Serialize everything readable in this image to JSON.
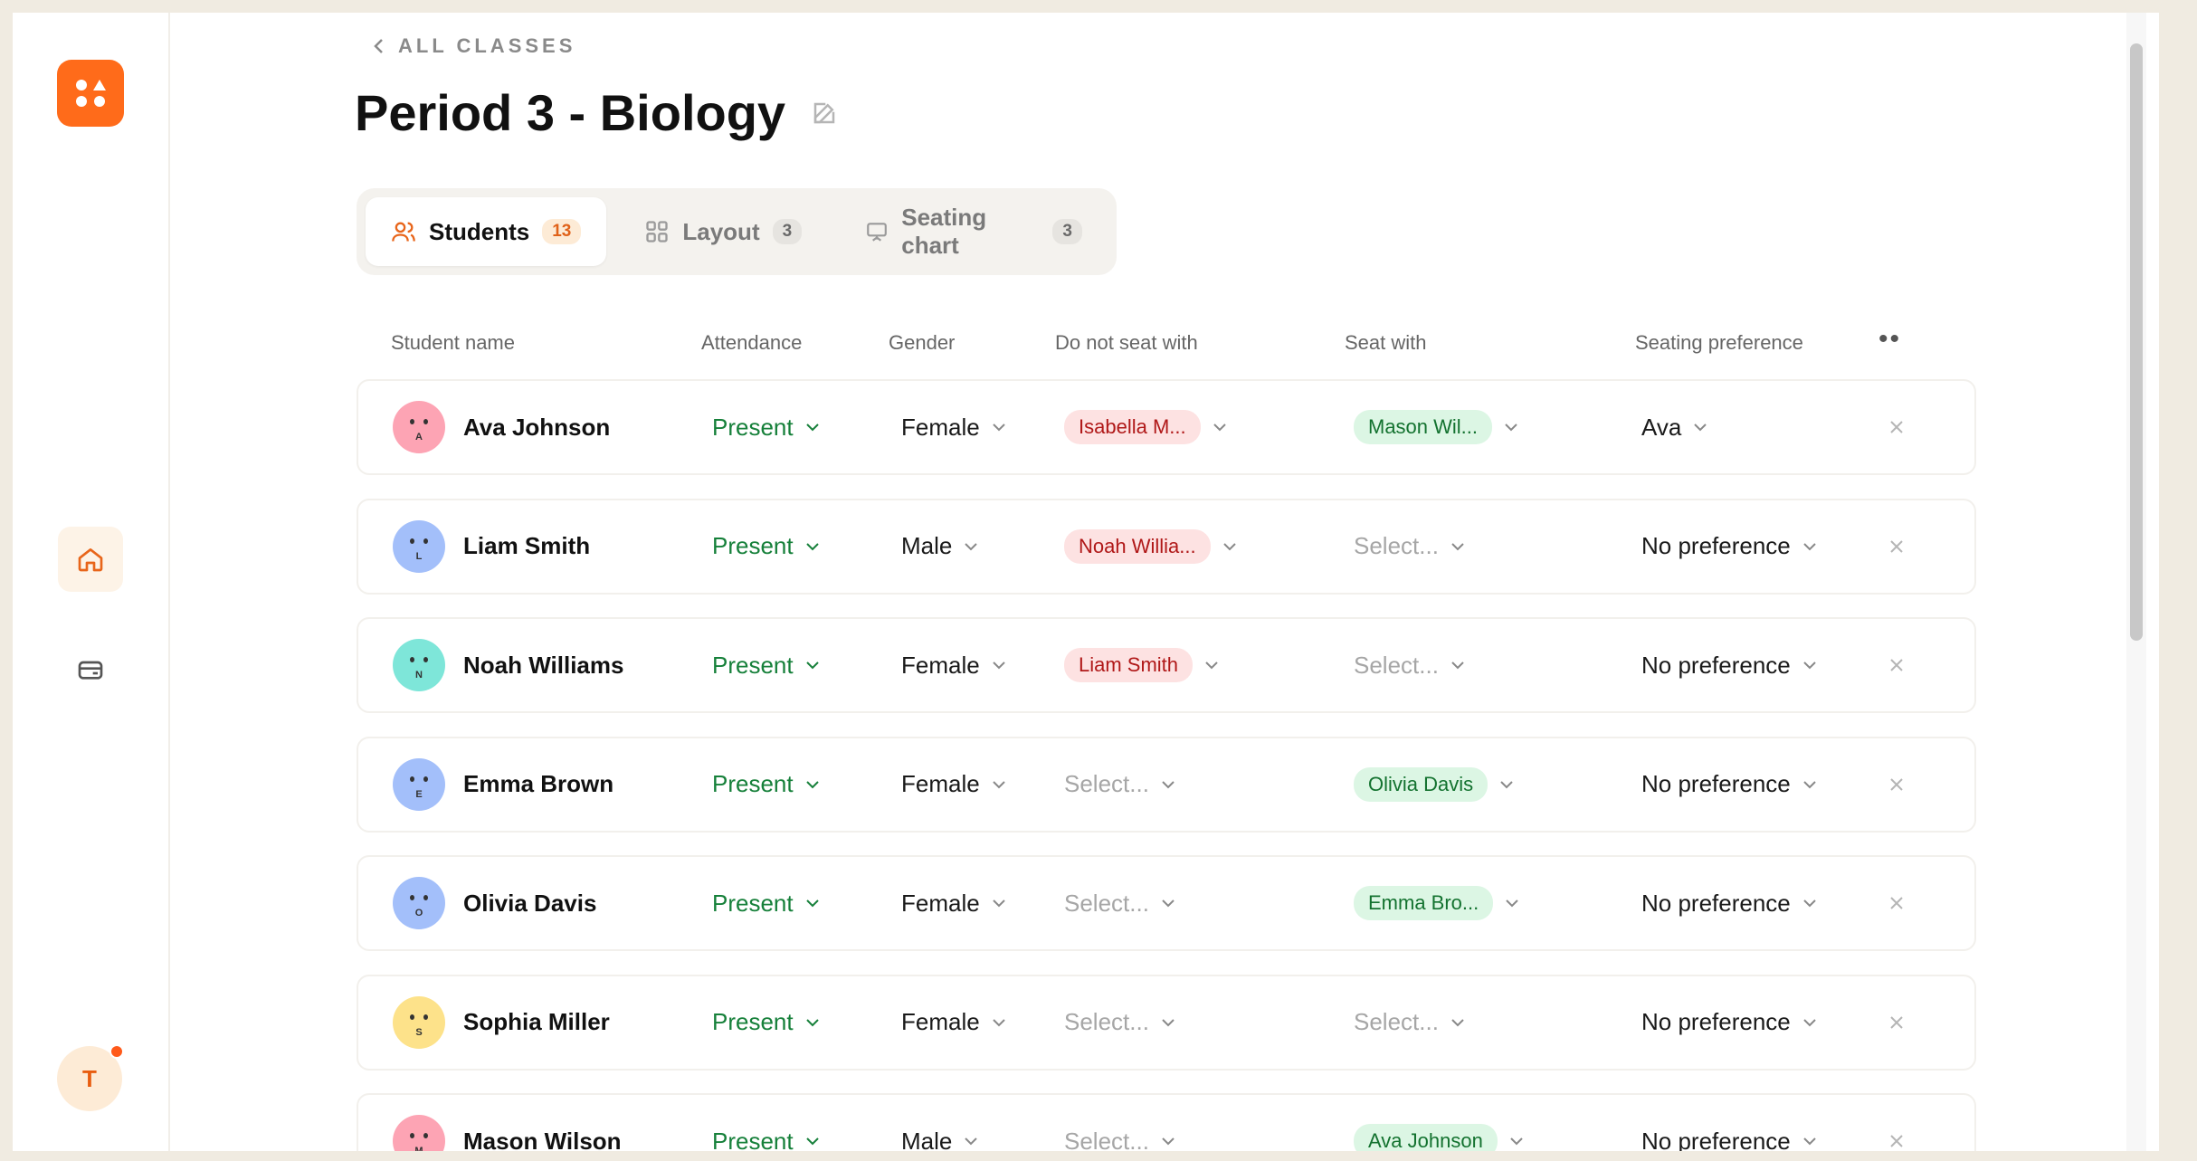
{
  "app": {
    "user_initial": "T"
  },
  "header": {
    "back_label": "ALL CLASSES",
    "title": "Period 3 - Biology"
  },
  "tabs": [
    {
      "label": "Students",
      "count": "13",
      "active": true
    },
    {
      "label": "Layout",
      "count": "3",
      "active": false
    },
    {
      "label": "Seating chart",
      "count": "3",
      "active": false
    }
  ],
  "table": {
    "columns": [
      "Student name",
      "Attendance",
      "Gender",
      "Do not seat with",
      "Seat with",
      "Seating preference"
    ],
    "rows": [
      {
        "name": "Ava Johnson",
        "initial": "A",
        "color": "#fda4b4",
        "attendance": "Present",
        "gender": "Female",
        "do_not_seat": "Isabella M...",
        "seat_with": "Mason Wil...",
        "preference": "Ava"
      },
      {
        "name": "Liam Smith",
        "initial": "L",
        "color": "#a3bffa",
        "attendance": "Present",
        "gender": "Male",
        "do_not_seat": "Noah Willia...",
        "seat_with": "",
        "preference": "No preference"
      },
      {
        "name": "Noah Williams",
        "initial": "N",
        "color": "#7ee6d9",
        "attendance": "Present",
        "gender": "Female",
        "do_not_seat": "Liam Smith",
        "seat_with": "",
        "preference": "No preference"
      },
      {
        "name": "Emma Brown",
        "initial": "E",
        "color": "#a3bffa",
        "attendance": "Present",
        "gender": "Female",
        "do_not_seat": "",
        "seat_with": "Olivia Davis",
        "preference": "No preference"
      },
      {
        "name": "Olivia Davis",
        "initial": "O",
        "color": "#a3bffa",
        "attendance": "Present",
        "gender": "Female",
        "do_not_seat": "",
        "seat_with": "Emma Bro...",
        "preference": "No preference"
      },
      {
        "name": "Sophia Miller",
        "initial": "S",
        "color": "#fde28a",
        "attendance": "Present",
        "gender": "Female",
        "do_not_seat": "",
        "seat_with": "",
        "preference": "No preference"
      },
      {
        "name": "Mason Wilson",
        "initial": "M",
        "color": "#fda4b4",
        "attendance": "Present",
        "gender": "Male",
        "do_not_seat": "",
        "seat_with": "Ava Johnson",
        "preference": "No preference"
      }
    ],
    "select_placeholder": "Select..."
  }
}
